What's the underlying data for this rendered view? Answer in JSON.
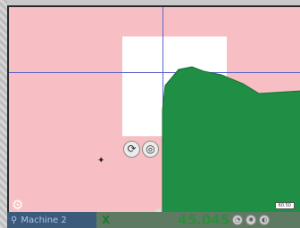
{
  "viewport": {
    "colors": {
      "background": "#f7bfc3",
      "stock": "#ffffff",
      "toolpath": "#1f8f45",
      "guides": "#5862c9"
    }
  },
  "view_tools": [
    {
      "icon": "rotate-view-icon",
      "glyph": "⟳"
    },
    {
      "icon": "orbit-view-icon",
      "glyph": "◎"
    }
  ],
  "settings": {
    "icon": "gear-icon",
    "glyph": "⚙"
  },
  "scale_badge": {
    "text": "60.50"
  },
  "dro": {
    "machine_name": "Machine 2",
    "machine_icon": "probe-icon",
    "axis": "X",
    "value": "45.045",
    "icons": [
      "zero-axis-icon",
      "home-axis-icon",
      "spindle-icon"
    ]
  }
}
